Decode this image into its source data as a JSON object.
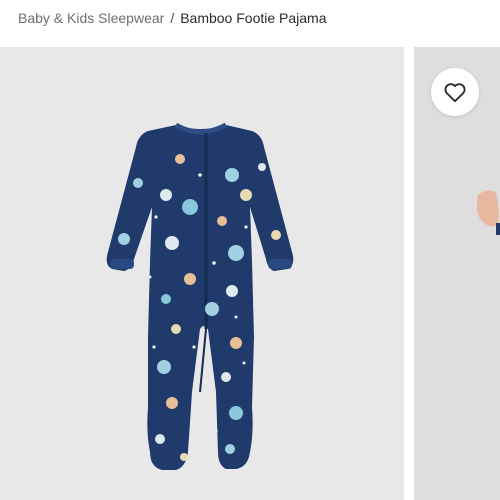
{
  "breadcrumb": {
    "parent": "Baby & Kids Sleepwear",
    "separator": "/",
    "current": "Bamboo Footie Pajama"
  },
  "gallery": {
    "background_main": "#e8e8e8",
    "background_next": "#dedede",
    "product_color": "#1f3a6b",
    "print_colors": [
      "#a9d8ea",
      "#f2c59a",
      "#eaf3f7",
      "#8fcfe3",
      "#f3e3b5"
    ]
  },
  "wishlist": {
    "icon": "heart-outline-icon"
  }
}
